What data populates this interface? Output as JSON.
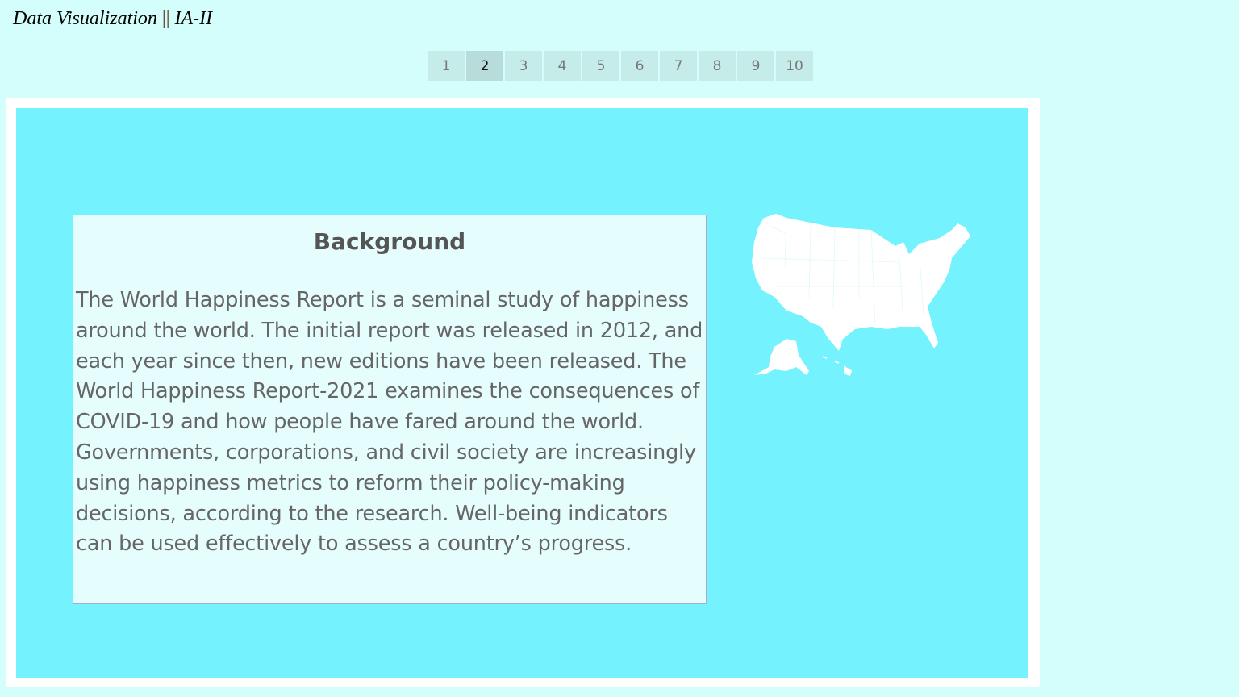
{
  "header": {
    "title_left": "Data Visualization",
    "separator": "||",
    "title_right": "IA-II"
  },
  "pagination": {
    "pages": [
      "1",
      "2",
      "3",
      "4",
      "5",
      "6",
      "7",
      "8",
      "9",
      "10"
    ],
    "active": "2"
  },
  "card": {
    "heading": "Background",
    "body": "The World Happiness Report is a seminal study of happiness around the world. The initial report was released in 2012, and each year since then, new editions have been released. The World Happiness Report-2021 examines the consequences of COVID-19 and how people have fared around the world. Governments, corporations, and civil society are increasingly using happiness metrics to reform their policy-making decisions, according to the research. Well-being indicators can be used effectively to assess a country’s progress."
  },
  "colors": {
    "page_bg": "#d4fefb",
    "dashboard_bg": "#74f2fd",
    "card_bg": "#e6fdfe"
  }
}
